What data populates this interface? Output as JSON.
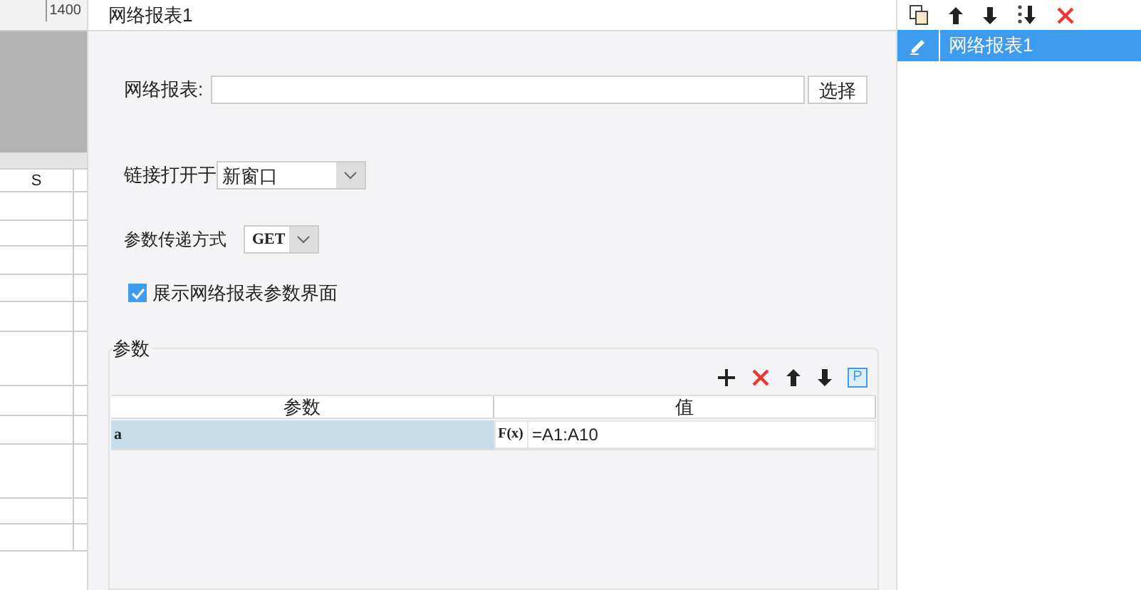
{
  "sheet": {
    "ruler_label": "1400",
    "column_header": "S"
  },
  "dialog": {
    "title": "网络报表1",
    "report_label": "网络报表:",
    "choose_button": "选择",
    "open_label": "链接打开于",
    "open_value": "新窗口",
    "method_label": "参数传递方式",
    "method_value": "GET",
    "show_params": {
      "label": "展示网络报表参数界面",
      "checked": true
    },
    "params": {
      "legend": "参数",
      "columns": [
        "参数",
        "值"
      ],
      "rows": [
        {
          "name": "a",
          "value": "=A1:A10",
          "selected": true
        }
      ],
      "formula_button": "F(x)",
      "parameter_button": "P"
    }
  },
  "list": {
    "items": [
      {
        "label": "网络报表1",
        "selected": true
      }
    ]
  }
}
